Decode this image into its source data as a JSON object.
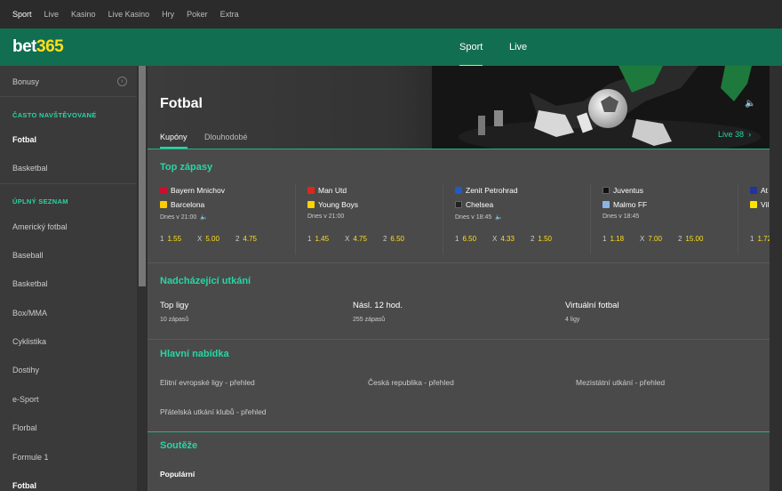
{
  "topnav": {
    "items": [
      "Sport",
      "Live",
      "Kasino",
      "Live Kasino",
      "Hry",
      "Poker",
      "Extra"
    ]
  },
  "header": {
    "logo_main": "bet",
    "logo_accent": "365",
    "nav": [
      "Sport",
      "Live"
    ]
  },
  "sidebar": {
    "bonus": "Bonusy",
    "section_frequent": "ČASTO NAVŠTĚVOVANÉ",
    "frequent": [
      "Fotbal",
      "Basketbal"
    ],
    "section_full": "ÚPLNÝ SEZNAM",
    "full": [
      "Americký fotbal",
      "Baseball",
      "Basketbal",
      "Box/MMA",
      "Cyklistika",
      "Dostihy",
      "e-Sport",
      "Florbal",
      "Formule 1",
      "Fotbal"
    ]
  },
  "hero": {
    "title": "Fotbal",
    "tabs": [
      "Kupóny",
      "Dlouhodobé"
    ],
    "live_label": "Live",
    "live_count": "38"
  },
  "top_matches": {
    "title": "Top zápasy",
    "matches": [
      {
        "home": "Bayern Mnichov",
        "away": "Barcelona",
        "time": "Dnes v 21:00",
        "o1": "1.55",
        "ox": "5.00",
        "o2": "4.75",
        "home_color": "#c8102e",
        "away_color": "#ffcc00",
        "has_sound": true
      },
      {
        "home": "Man Utd",
        "away": "Young Boys",
        "time": "Dnes v 21:00",
        "o1": "1.45",
        "ox": "4.75",
        "o2": "6.50",
        "home_color": "#da291c",
        "away_color": "#ffd200",
        "has_sound": false
      },
      {
        "home": "Zenit Petrohrad",
        "away": "Chelsea",
        "time": "Dnes v 18:45",
        "o1": "6.50",
        "ox": "4.33",
        "o2": "1.50",
        "home_color": "#1e5bc6",
        "away_color": "#222222",
        "has_sound": true
      },
      {
        "home": "Juventus",
        "away": "Malmo FF",
        "time": "Dnes v 18:45",
        "o1": "1.18",
        "ox": "7.00",
        "o2": "15.00",
        "home_color": "#111111",
        "away_color": "#8ab4e8",
        "has_sound": false
      },
      {
        "home": "At",
        "away": "Vil",
        "time": "",
        "o1": "1.72",
        "ox": "",
        "o2": "",
        "home_color": "#223399",
        "away_color": "#ffe100",
        "has_sound": false
      }
    ],
    "labels": {
      "one": "1",
      "x": "X",
      "two": "2"
    }
  },
  "upcoming": {
    "title": "Nadcházející utkání",
    "items": [
      {
        "label": "Top ligy",
        "sub": "10 zápasů"
      },
      {
        "label": "Násl. 12 hod.",
        "sub": "255 zápasů"
      },
      {
        "label": "Virtuální fotbal",
        "sub": "4 ligy"
      }
    ]
  },
  "main_offer": {
    "title": "Hlavní nabídka",
    "links": [
      "Elitní evropské ligy - přehled",
      "Česká republika - přehled",
      "Mezistátní utkání - přehled",
      "Přátelská utkání klubů - přehled"
    ]
  },
  "competitions": {
    "title": "Soutěže",
    "popular": "Populární"
  },
  "colors": {
    "brand_green": "#126e51",
    "accent_teal": "#26d6a4",
    "odds_yellow": "#ffdf1b"
  }
}
